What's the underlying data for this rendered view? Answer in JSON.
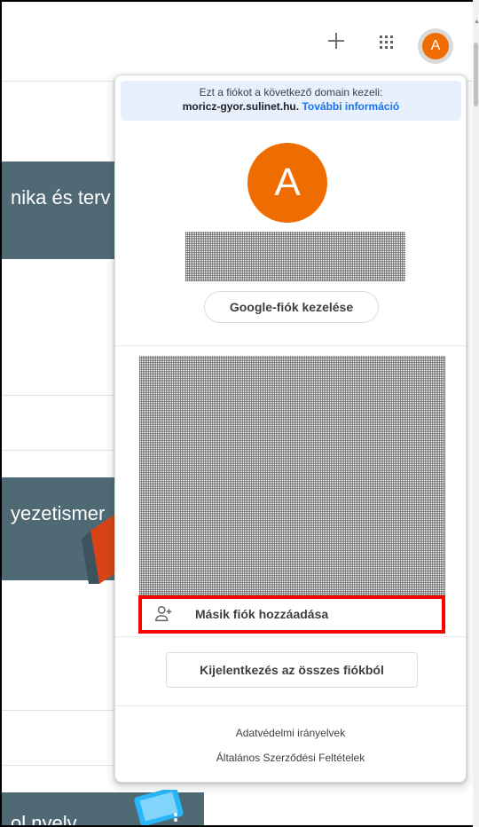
{
  "panel": {
    "domain_note_line1": "Ezt a fiókot a következő domain kezeli:",
    "domain_name": "moricz-gyor.sulinet.hu.",
    "more_info_link": "További információ",
    "avatar_letter": "A",
    "manage_account_button": "Google-fiók kezelése",
    "add_account_label": "Másik fiók hozzáadása",
    "sign_out_all_button": "Kijelentkezés az összes fiókból",
    "footer_links": [
      "Adatvédelmi irányelvek",
      "Általános Szerződési Feltételek"
    ]
  },
  "topbar": {
    "avatar_letter": "A",
    "plus_icon": "plus-icon",
    "apps_icon": "apps-grid-icon"
  },
  "background_cards": [
    {
      "title_fragment": "nika és terv"
    },
    {
      "title_fragment": "yezetismer"
    },
    {
      "title_fragment": "ol nyelv"
    }
  ],
  "colors": {
    "avatar": "#ef6c00",
    "banner": "#4f6975",
    "link": "#1a73e8",
    "highlight": "#ff0000"
  }
}
